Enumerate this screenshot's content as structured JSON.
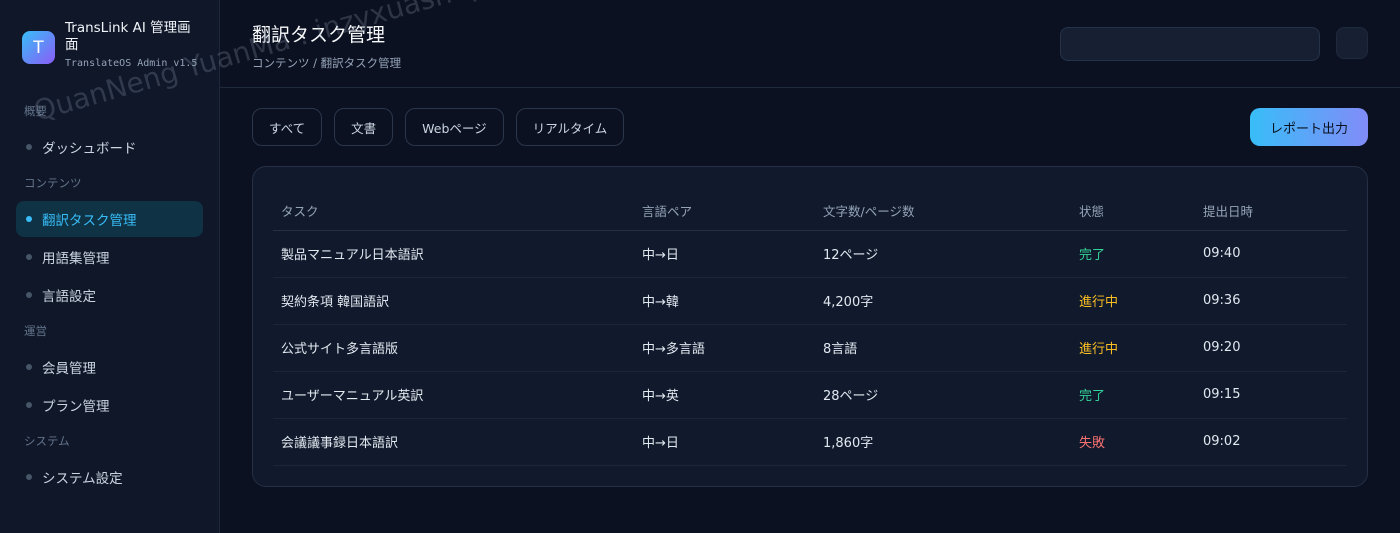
{
  "brand": {
    "logo_letter": "T",
    "title": "TransLink AI 管理画面",
    "subtitle": "TranslateOS Admin v1.5"
  },
  "nav": {
    "groups": [
      {
        "label": "概要",
        "items": [
          {
            "label": "ダッシュボード"
          }
        ]
      },
      {
        "label": "コンテンツ",
        "items": [
          {
            "label": "翻訳タスク管理"
          },
          {
            "label": "用語集管理"
          },
          {
            "label": "言語設定"
          }
        ]
      },
      {
        "label": "運営",
        "items": [
          {
            "label": "会員管理"
          },
          {
            "label": "プラン管理"
          }
        ]
      },
      {
        "label": "システム",
        "items": [
          {
            "label": "システム設定"
          }
        ]
      }
    ]
  },
  "header": {
    "title": "翻訳タスク管理",
    "breadcrumb": "コンテンツ / 翻訳タスク管理",
    "search_value": ""
  },
  "filters": [
    "すべて",
    "文書",
    "Webページ",
    "リアルタイム"
  ],
  "report_button": "レポート出力",
  "table": {
    "columns": [
      "タスク",
      "言語ペア",
      "文字数/ページ数",
      "状態",
      "提出日時"
    ],
    "rows": [
      {
        "task": "製品マニュアル日本語訳",
        "pair": "中→日",
        "count": "12ページ",
        "status": "完了",
        "time": "09:40"
      },
      {
        "task": "契約条項 韓国語訳",
        "pair": "中→韓",
        "count": "4,200字",
        "status": "進行中",
        "time": "09:36"
      },
      {
        "task": "公式サイト多言語版",
        "pair": "中→多言語",
        "count": "8言語",
        "status": "進行中",
        "time": "09:20"
      },
      {
        "task": "ユーザーマニュアル英訳",
        "pair": "中→英",
        "count": "28ページ",
        "status": "完了",
        "time": "09:15"
      },
      {
        "task": "会議議事録日本語訳",
        "pair": "中→日",
        "count": "1,860字",
        "status": "失敗",
        "time": "09:02"
      }
    ]
  },
  "watermark": "QuanNeng YuanMa : inzyxuashop.com",
  "colors": {
    "accent": "#38bdf8",
    "done": "#34d399",
    "in_progress": "#fbbf24",
    "failed": "#f87171"
  }
}
